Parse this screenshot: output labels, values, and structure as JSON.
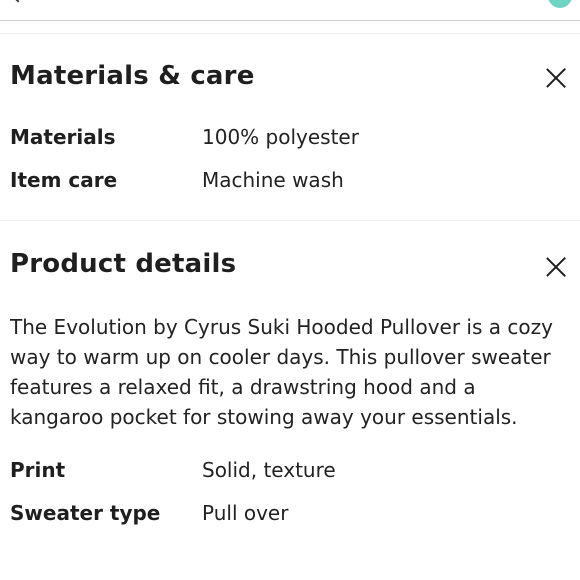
{
  "materials_care": {
    "title": "Materials & care",
    "rows": [
      {
        "label": "Materials",
        "value": "100% polyester"
      },
      {
        "label": "Item care",
        "value": "Machine wash"
      }
    ]
  },
  "product_details": {
    "title": "Product details",
    "description": "The Evolution by Cyrus Suki Hooded Pullover is a cozy way to warm up on cooler days. This pullover sweater features a relaxed fit, a drawstring hood and a kangaroo pocket for stowing away your essentials.",
    "rows": [
      {
        "label": "Print",
        "value": "Solid, texture"
      },
      {
        "label": "Sweater type",
        "value": "Pull over"
      }
    ]
  },
  "icons": {
    "close": "close-icon",
    "back": "back-chevron-icon"
  },
  "colors": {
    "badge": "#6fd3c4",
    "text": "#1f1f1f",
    "divider": "#eeeeee"
  }
}
